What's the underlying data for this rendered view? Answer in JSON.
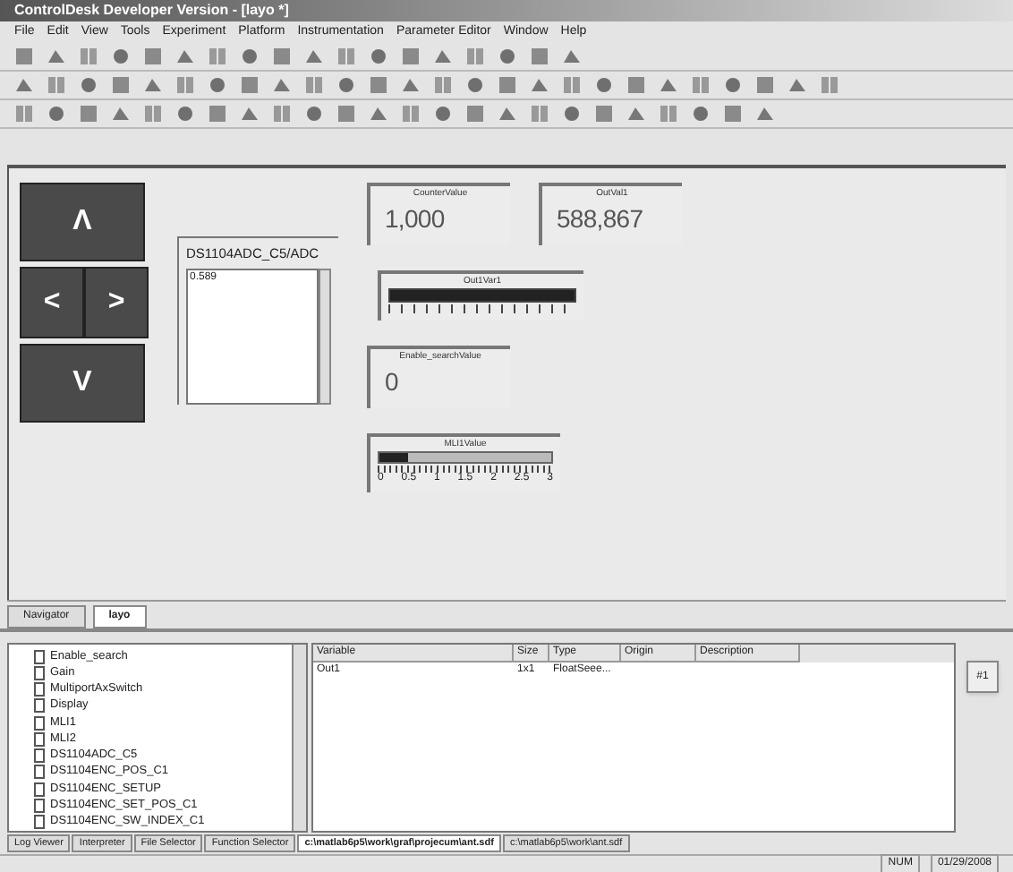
{
  "window": {
    "title": "ControlDesk Developer Version - [layo *]"
  },
  "menu": [
    "File",
    "Edit",
    "View",
    "Tools",
    "Experiment",
    "Platform",
    "Instrumentation",
    "Parameter Editor",
    "Window",
    "Help"
  ],
  "layout": {
    "buttons": [
      {
        "label": "Λ",
        "kind": "wide"
      },
      {
        "label": "<",
        "kind": "half"
      },
      {
        "label": ">",
        "kind": "half"
      },
      {
        "label": "V",
        "kind": "wide"
      }
    ],
    "list_display": {
      "title": "DS1104ADC_C5/ADC",
      "value": "0.589"
    },
    "displays": [
      {
        "title": "CounterValue",
        "value": "1,000"
      },
      {
        "title": "OutVal1",
        "value": "588,867"
      }
    ],
    "bar_gauges": [
      {
        "title": "Out1Var1",
        "level": 1.0
      },
      {
        "title": "MLI1Value",
        "level": 0.167,
        "ticks": [
          "0",
          "0.5",
          "1",
          "1.5",
          "2",
          "2.5",
          "3"
        ]
      }
    ],
    "enable_display": {
      "title": "Enable_searchValue",
      "value": "0"
    }
  },
  "doc_tabs": [
    {
      "label": "Navigator",
      "selected": false
    },
    {
      "label": "layo",
      "selected": true
    }
  ],
  "tree": [
    "Enable_search",
    "Gain",
    "MultiportAxSwitch",
    "Display",
    "MLI1",
    "MLI2",
    "DS1104ADC_C5",
    "DS1104ENC_POS_C1",
    "DS1104ENC_SETUP",
    "DS1104ENC_SET_POS_C1",
    "DS1104ENC_SW_INDEX_C1"
  ],
  "table": {
    "columns": [
      "Variable",
      "Size",
      "Type",
      "Origin",
      "Description"
    ],
    "rows": [
      [
        "Out1",
        "1x1",
        "FloatSeee...",
        "",
        ""
      ]
    ]
  },
  "side_button": "#1",
  "bottom_tabs": [
    {
      "label": "Log Viewer",
      "selected": false
    },
    {
      "label": "Interpreter",
      "selected": false
    },
    {
      "label": "File Selector",
      "selected": false
    },
    {
      "label": "Function Selector",
      "selected": false
    },
    {
      "label": "c:\\matlab6p5\\work\\graf\\projecum\\ant.sdf",
      "selected": true
    },
    {
      "label": "c:\\matlab6p5\\work\\ant.sdf",
      "selected": false
    }
  ],
  "status_bar": [
    "NUM",
    "01/29/2008"
  ]
}
